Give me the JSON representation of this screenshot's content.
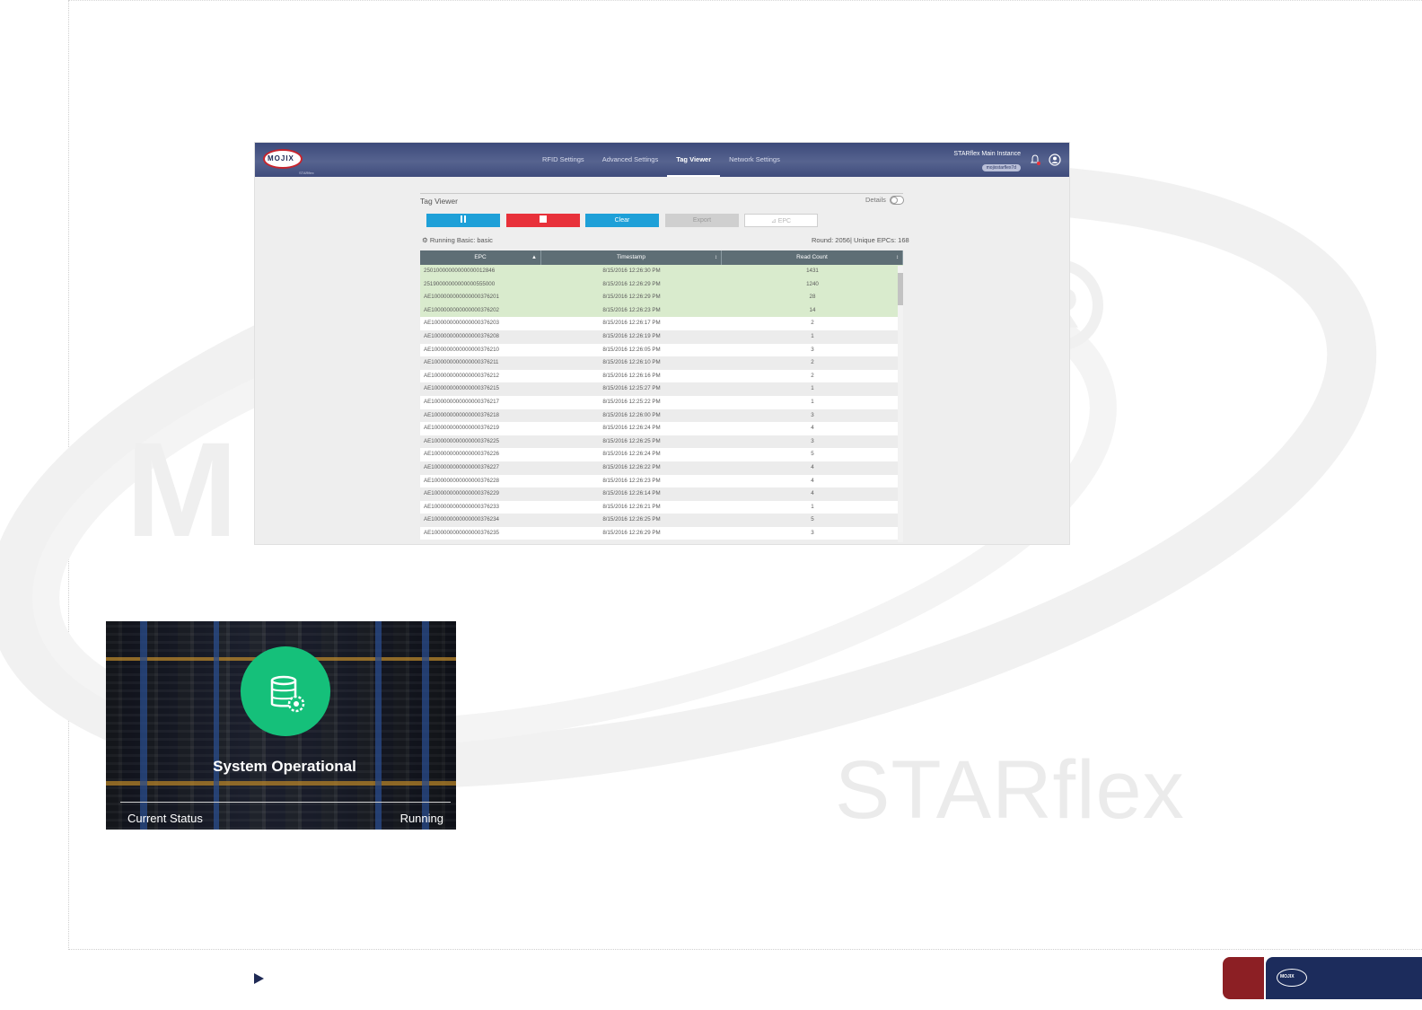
{
  "app": {
    "logo_text": "MOJIX",
    "logo_subtext": "STARflex",
    "nav": [
      "RFID Settings",
      "Advanced Settings",
      "Tag Viewer",
      "Network Settings"
    ],
    "active_nav": "Tag Viewer",
    "instance_name": "STARflex Main Instance",
    "instance_badge": "mojixstarflex7d"
  },
  "tag_viewer": {
    "title": "Tag Viewer",
    "details_label": "Details",
    "buttons": {
      "clear": "Clear",
      "export": "Export",
      "filter": "EPC"
    },
    "status_text": "Running Basic: basic",
    "round_text": "Round: 2056| Unique EPCs: 168",
    "columns": [
      "EPC",
      "Timestamp",
      "Read Count"
    ],
    "rows": [
      [
        "25010000000000000012846",
        "8/15/2016 12:26:30 PM",
        "1431"
      ],
      [
        "25190000000000000555000",
        "8/15/2016 12:26:29 PM",
        "1240"
      ],
      [
        "AE1000000000000000376201",
        "8/15/2016 12:26:29 PM",
        "28"
      ],
      [
        "AE1000000000000000376202",
        "8/15/2016 12:26:23 PM",
        "14"
      ],
      [
        "AE1000000000000000376203",
        "8/15/2016 12:26:17 PM",
        "2"
      ],
      [
        "AE1000000000000000376208",
        "8/15/2016 12:26:19 PM",
        "1"
      ],
      [
        "AE1000000000000000376210",
        "8/15/2016 12:26:05 PM",
        "3"
      ],
      [
        "AE1000000000000000376211",
        "8/15/2016 12:26:10 PM",
        "2"
      ],
      [
        "AE1000000000000000376212",
        "8/15/2016 12:26:16 PM",
        "2"
      ],
      [
        "AE1000000000000000376215",
        "8/15/2016 12:25:27 PM",
        "1"
      ],
      [
        "AE1000000000000000376217",
        "8/15/2016 12:25:22 PM",
        "1"
      ],
      [
        "AE1000000000000000376218",
        "8/15/2016 12:26:00 PM",
        "3"
      ],
      [
        "AE1000000000000000376219",
        "8/15/2016 12:26:24 PM",
        "4"
      ],
      [
        "AE1000000000000000376225",
        "8/15/2016 12:26:25 PM",
        "3"
      ],
      [
        "AE1000000000000000376226",
        "8/15/2016 12:26:24 PM",
        "5"
      ],
      [
        "AE1000000000000000376227",
        "8/15/2016 12:26:22 PM",
        "4"
      ],
      [
        "AE1000000000000000376228",
        "8/15/2016 12:26:23 PM",
        "4"
      ],
      [
        "AE1000000000000000376229",
        "8/15/2016 12:26:14 PM",
        "4"
      ],
      [
        "AE1000000000000000376233",
        "8/15/2016 12:26:21 PM",
        "1"
      ],
      [
        "AE1000000000000000376234",
        "8/15/2016 12:26:25 PM",
        "5"
      ],
      [
        "AE1000000000000000376235",
        "8/15/2016 12:26:29 PM",
        "3"
      ]
    ],
    "highlighted_rows": 4
  },
  "status_card": {
    "title": "System Operational",
    "label": "Current Status",
    "value": "Running",
    "icon": "database-gear-icon",
    "accent": "#15c07a"
  },
  "watermark": {
    "text": "STARflex",
    "brand_text": "MOJIX"
  },
  "colors": {
    "brand_red": "#8c1f24",
    "brand_blue": "#1c2c5c",
    "button_blue": "#1ea0d8",
    "button_red": "#e8313a"
  }
}
